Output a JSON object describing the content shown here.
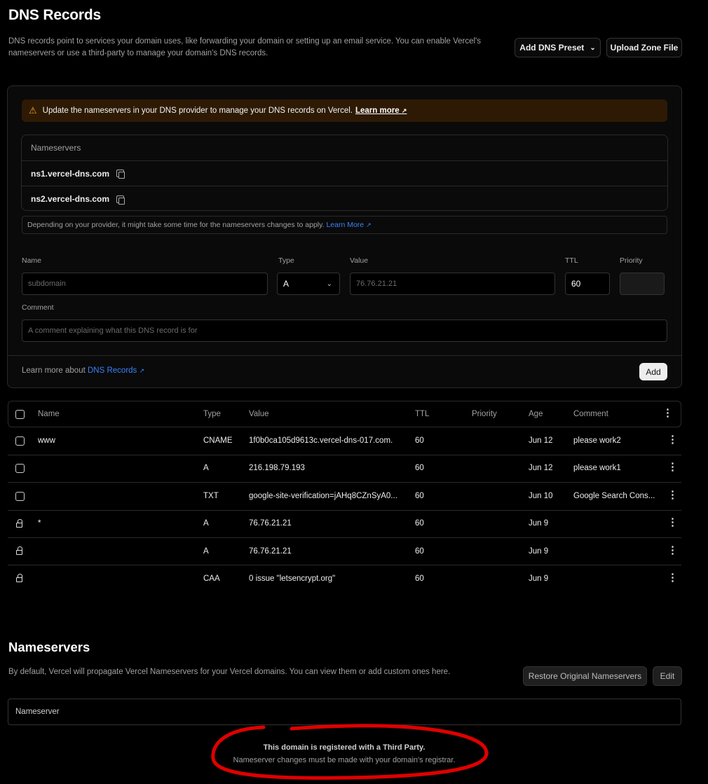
{
  "header": {
    "title": "DNS Records",
    "description": "DNS records point to services your domain uses, like forwarding your domain or setting up an email service. You can enable Vercel's nameservers or use a third-party to manage your domain's DNS records.",
    "add_preset_label": "Add DNS Preset",
    "upload_zone_label": "Upload Zone File"
  },
  "warning": {
    "text": "Update the nameservers in your DNS provider to manage your DNS records on Vercel.",
    "link": "Learn more"
  },
  "nameservers_box": {
    "header": "Nameservers",
    "items": [
      "ns1.vercel-dns.com",
      "ns2.vercel-dns.com"
    ],
    "note": "Depending on your provider, it might take some time for the nameservers changes to apply.",
    "note_link": "Learn More"
  },
  "form": {
    "name_label": "Name",
    "name_placeholder": "subdomain",
    "type_label": "Type",
    "type_value": "A",
    "value_label": "Value",
    "value_placeholder": "76.76.21.21",
    "ttl_label": "TTL",
    "ttl_value": "60",
    "priority_label": "Priority",
    "comment_label": "Comment",
    "comment_placeholder": "A comment explaining what this DNS record is for",
    "learn_prefix": "Learn more about",
    "learn_link": "DNS Records",
    "add_label": "Add"
  },
  "table": {
    "headers": {
      "name": "Name",
      "type": "Type",
      "value": "Value",
      "ttl": "TTL",
      "priority": "Priority",
      "age": "Age",
      "comment": "Comment"
    },
    "rows": [
      {
        "locked": false,
        "name": "www",
        "type": "CNAME",
        "value": "1f0b0ca105d9613c.vercel-dns-017.com.",
        "ttl": "60",
        "age": "Jun 12",
        "comment": "please work2"
      },
      {
        "locked": false,
        "name": "",
        "type": "A",
        "value": "216.198.79.193",
        "ttl": "60",
        "age": "Jun 12",
        "comment": "please work1"
      },
      {
        "locked": false,
        "name": "",
        "type": "TXT",
        "value": "google-site-verification=jAHq8CZnSyA0...",
        "ttl": "60",
        "age": "Jun 10",
        "comment": "Google Search Cons..."
      },
      {
        "locked": true,
        "name": "*",
        "type": "A",
        "value": "76.76.21.21",
        "ttl": "60",
        "age": "Jun 9",
        "comment": ""
      },
      {
        "locked": true,
        "name": "",
        "type": "A",
        "value": "76.76.21.21",
        "ttl": "60",
        "age": "Jun 9",
        "comment": ""
      },
      {
        "locked": true,
        "name": "",
        "type": "CAA",
        "value": "0 issue \"letsencrypt.org\"",
        "ttl": "60",
        "age": "Jun 9",
        "comment": ""
      }
    ]
  },
  "nameservers_section": {
    "title": "Nameservers",
    "description": "By default, Vercel will propagate Vercel Nameservers for your Vercel domains. You can view them or add custom ones here.",
    "restore_label": "Restore Original Nameservers",
    "edit_label": "Edit",
    "field_label": "Nameserver",
    "third_party_title": "This domain is registered with a Third Party.",
    "third_party_text": "Nameserver changes must be made with your domain's registrar."
  }
}
